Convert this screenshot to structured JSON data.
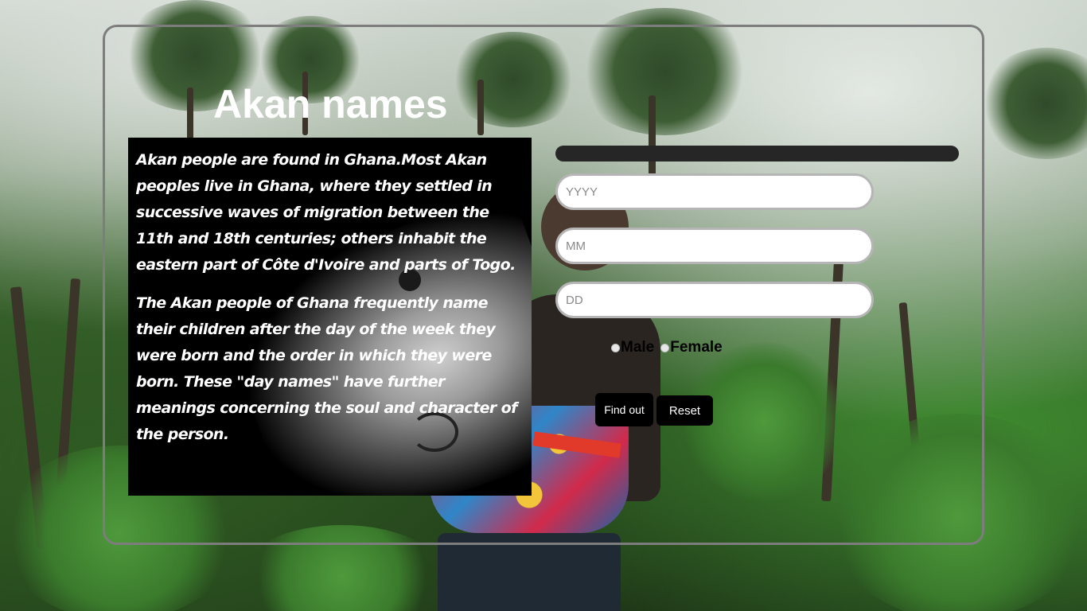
{
  "header": {
    "title": "Akan names"
  },
  "info": {
    "paragraphs": [
      "Akan people are found in Ghana.Most Akan peoples live in Ghana, where they settled in successive waves of migration between the 11th and 18th centuries; others inhabit the eastern part of Côte d'Ivoire and parts of Togo.",
      "The Akan people of Ghana frequently name their children after the day of the week they were born and the order in which they were born. These \"day names\" have further meanings concerning the soul and character of the person."
    ]
  },
  "form": {
    "year_placeholder": "YYYY",
    "month_placeholder": "MM",
    "day_placeholder": "DD",
    "gender_options": [
      "Male",
      "Female"
    ],
    "find_label": "Find out",
    "reset_label": "Reset"
  },
  "colors": {
    "frame_border": "#7d7d7d",
    "button_bg": "#000000",
    "info_bg": "#000000",
    "bar_bg": "#262626"
  }
}
